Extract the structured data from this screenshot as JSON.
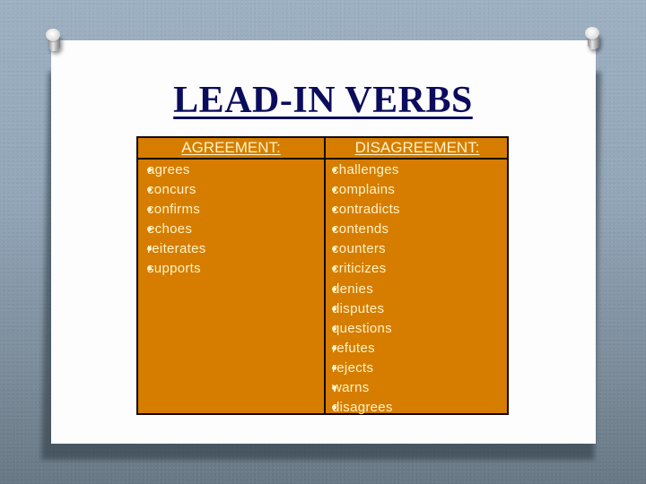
{
  "slide": {
    "title": "LEAD-IN VERBS",
    "colors": {
      "title": "#0c0c5c",
      "table_fill": "#d67d00",
      "table_text": "#fff4c8",
      "border": "#120800",
      "card": "#fdfdfd"
    },
    "table": {
      "headers": [
        "AGREEMENT:",
        "DISAGREEMENT:"
      ],
      "agreement": [
        "agrees",
        "concurs",
        "confirms",
        "echoes",
        "reiterates",
        "supports"
      ],
      "disagreement": [
        "challenges",
        "complains",
        "contradicts",
        "contends",
        "counters",
        "criticizes",
        "denies",
        "disputes",
        "questions",
        "refutes",
        "rejects",
        "warns",
        "disagrees"
      ]
    },
    "icons": {
      "bullet": "bullet-icon",
      "pin": "push-pin-icon"
    }
  }
}
